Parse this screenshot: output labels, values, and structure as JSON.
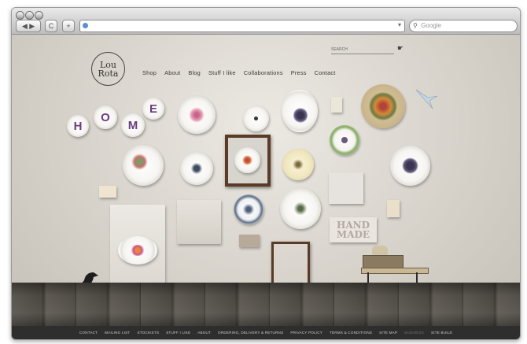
{
  "browser": {
    "back_label": "◀ ▶",
    "reload_label": "C",
    "add_label": "+",
    "search_placeholder": "Google"
  },
  "site": {
    "logo_line1": "Lou",
    "logo_line2": "Rota",
    "search_label": "SEARCH",
    "nav": [
      "Shop",
      "About",
      "Blog",
      "Stuff I like",
      "Collaborations",
      "Press",
      "Contact"
    ],
    "home_letters": [
      "H",
      "O",
      "M",
      "E"
    ],
    "handmade_line1": "HAND",
    "handmade_line2": "MADE",
    "footer": [
      {
        "label": "CONTACT",
        "dim": false
      },
      {
        "label": "MAILING LIST",
        "dim": false
      },
      {
        "label": "STOCKISTS",
        "dim": false
      },
      {
        "label": "STUFF I LIKE",
        "dim": false
      },
      {
        "label": "ABOUT",
        "dim": false
      },
      {
        "label": "ORDERING, DELIVERY & RETURNS",
        "dim": false
      },
      {
        "label": "PRIVACY POLICY",
        "dim": false
      },
      {
        "label": "TERMS & CONDITIONS",
        "dim": false
      },
      {
        "label": "SITE MAP",
        "dim": false
      },
      {
        "label": "BUSINESS",
        "dim": true
      },
      {
        "label": "SITE BUILD",
        "dim": false
      }
    ]
  },
  "colors": {
    "wall": "#d8d5cf",
    "floor": "#4d4944",
    "footer": "#2e2e2e",
    "frame": "#5a3b27",
    "home_letter": "#6a3b7c"
  }
}
